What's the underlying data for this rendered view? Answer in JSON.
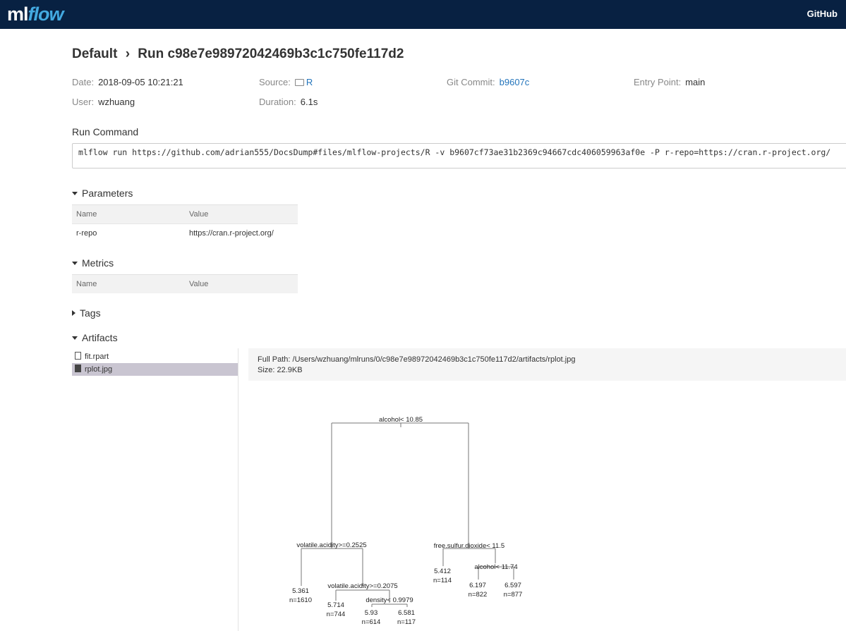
{
  "header": {
    "logo_ml": "ml",
    "logo_flow": "flow",
    "github": "GitHub"
  },
  "breadcrumb": {
    "experiment": "Default",
    "separator": "›",
    "run": "Run c98e7e98972042469b3c1c750fe117d2"
  },
  "meta": {
    "date_label": "Date:",
    "date": "2018-09-05 10:21:21",
    "source_label": "Source:",
    "source": "R",
    "git_label": "Git Commit:",
    "git": "b9607c",
    "entry_label": "Entry Point:",
    "entry": "main",
    "user_label": "User:",
    "user": "wzhuang",
    "duration_label": "Duration:",
    "duration": "6.1s"
  },
  "run_command": {
    "title": "Run Command",
    "command": "mlflow run https://github.com/adrian555/DocsDump#files/mlflow-projects/R -v b9607cf73ae31b2369c94667cdc406059963af0e -P r-repo=https://cran.r-project.org/"
  },
  "parameters": {
    "title": "Parameters",
    "col_name": "Name",
    "col_value": "Value",
    "rows": [
      {
        "name": "r-repo",
        "value": "https://cran.r-project.org/"
      }
    ]
  },
  "metrics": {
    "title": "Metrics",
    "col_name": "Name",
    "col_value": "Value"
  },
  "tags": {
    "title": "Tags"
  },
  "artifacts": {
    "title": "Artifacts",
    "files": [
      {
        "name": "fit.rpart",
        "selected": false
      },
      {
        "name": "rplot.jpg",
        "selected": true
      }
    ],
    "full_path": "Full Path: /Users/wzhuang/mlruns/0/c98e7e98972042469b3c1c750fe117d2/artifacts/rplot.jpg",
    "size": "Size: 22.9KB"
  },
  "tree_plot": {
    "splits": {
      "root": "alcohol< 10.85",
      "va1": "volatile.acidity>=0.2525",
      "fsd": "free.sulfur.dioxide< 11.5",
      "va2": "volatile.acidity>=0.2075",
      "alc2": "alcohol< 11.74",
      "dens": "density< 0.9979"
    },
    "leaves": {
      "l1": {
        "value": "5.361",
        "n": "n=1610"
      },
      "l2": {
        "value": "5.714",
        "n": "n=744"
      },
      "l3": {
        "value": "5.93",
        "n": "n=614"
      },
      "l4": {
        "value": "6.581",
        "n": "n=117"
      },
      "l5": {
        "value": "5.412",
        "n": "n=114"
      },
      "l6": {
        "value": "6.197",
        "n": "n=822"
      },
      "l7": {
        "value": "6.597",
        "n": "n=877"
      }
    }
  }
}
